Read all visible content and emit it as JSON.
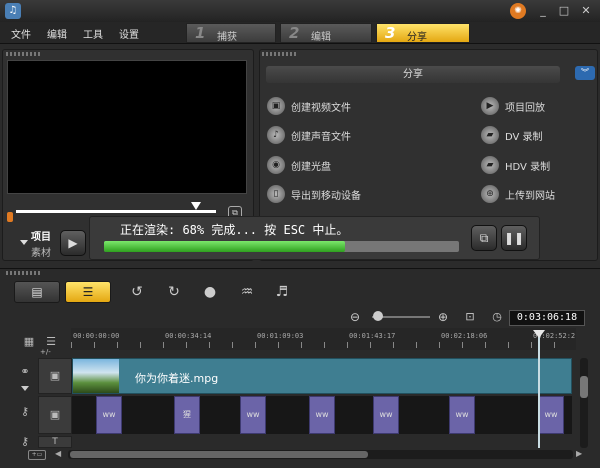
{
  "menu": [
    "文件",
    "编辑",
    "工具",
    "设置"
  ],
  "steps": [
    {
      "num": "1",
      "label": "捕获"
    },
    {
      "num": "2",
      "label": "编辑"
    },
    {
      "num": "3",
      "label": "分享"
    }
  ],
  "player": {
    "project_label": "项目",
    "clip_label": "素材"
  },
  "share": {
    "header": "分享",
    "left_items": [
      "创建视频文件",
      "创建声音文件",
      "创建光盘",
      "导出到移动设备"
    ],
    "right_items": [
      "项目回放",
      "DV 录制",
      "HDV 录制",
      "上传到网站"
    ]
  },
  "render": {
    "status": "正在渲染: 68% 完成... 按 ESC 中止。",
    "progress": 0.68
  },
  "timeline": {
    "timecode": "0:03:06:18",
    "ruler": [
      "00:00:00:00",
      "00:00:34:14",
      "00:01:09:03",
      "00:01:43:17",
      "00:02:18:06",
      "00:02:52:2"
    ],
    "clip_name": "你为你着迷.mpg",
    "overlay_labels": [
      "ww",
      "猩",
      "ww",
      "ww",
      "ww",
      "ww",
      "ww"
    ],
    "add_label": "+/-"
  },
  "colors": {
    "accent": "#e4a712",
    "clip": "#3f7e91",
    "overlay": "#6b64a8",
    "progress": "#2fa01f"
  }
}
